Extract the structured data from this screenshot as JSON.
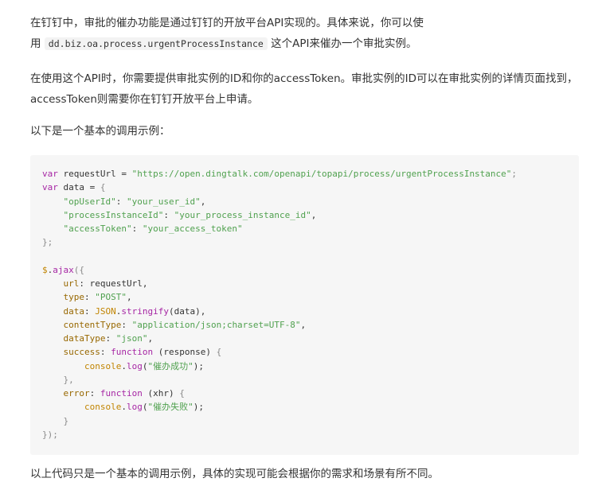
{
  "paragraphs": {
    "p1_part1": "在钉钉中，审批的催办功能是通过钉钉的开放平台API实现的。具体来说，你可以使",
    "p1_part2": "用",
    "p1_code": "dd.biz.oa.process.urgentProcessInstance",
    "p1_part3": "这个API来催办一个审批实例。",
    "p2": "在使用这个API时，你需要提供审批实例的ID和你的accessToken。审批实例的ID可以在审批实例的详情页面找到，accessToken则需要你在钉钉开放平台上申请。",
    "p3": "以下是一个基本的调用示例："
  },
  "code": {
    "url_value": "\"https://open.dingtalk.com/openapi/topapi/process/urgentProcessInstance\"",
    "opUserId_value": "\"your_user_id\"",
    "processInstanceId_value": "\"your_process_instance_id\"",
    "accessToken_value": "\"your_access_token\"",
    "type_value": "\"POST\"",
    "contentType_value": "\"application/json;charset=UTF-8\"",
    "dataType_value": "\"json\"",
    "success_msg": "\"催办成功\"",
    "error_msg": "\"催办失败\""
  },
  "footer_cut": "以上代码只是一个基本的调用示例，具体的实现可能会根据你的需求和场景有所不同。"
}
